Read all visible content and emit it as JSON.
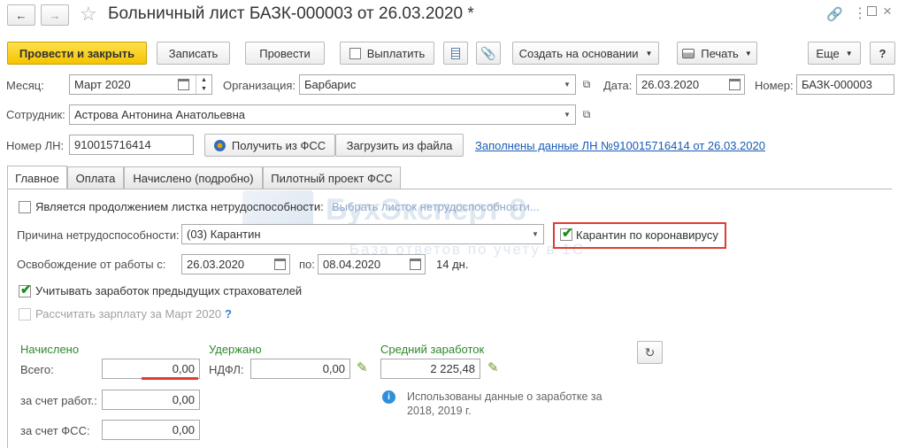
{
  "titlebar": {
    "title": "Больничный лист БАЗК-000003 от 26.03.2020 *"
  },
  "toolbar": {
    "post_close": "Провести и закрыть",
    "save": "Записать",
    "post": "Провести",
    "pay": "Выплатить",
    "create_based": "Создать на основании",
    "print": "Печать",
    "more": "Еще",
    "help": "?"
  },
  "header": {
    "month_label": "Месяц:",
    "month_value": "Март 2020",
    "org_label": "Организация:",
    "org_value": "Барбарис",
    "date_label": "Дата:",
    "date_value": "26.03.2020",
    "number_label": "Номер:",
    "number_value": "БАЗК-000003",
    "employee_label": "Сотрудник:",
    "employee_value": "Астрова Антонина Анатольевна",
    "ln_label": "Номер ЛН:",
    "ln_value": "910015716414",
    "get_fss": "Получить из ФСС",
    "load_file": "Загрузить из файла",
    "filled_link": "Заполнены данные ЛН №910015716414 от 26.03.2020"
  },
  "tabs": [
    "Главное",
    "Оплата",
    "Начислено (подробно)",
    "Пилотный проект ФСС"
  ],
  "main": {
    "continuation_label": "Является продолжением листка нетрудоспособности:",
    "choose_link": "Выбрать листок нетрудоспособности...",
    "reason_label": "Причина нетрудоспособности:",
    "reason_value": "(03) Карантин",
    "covid_label": "Карантин по коронавирусу",
    "release_label": "Освобождение от работы с:",
    "release_from": "26.03.2020",
    "to_label": "по:",
    "release_to": "08.04.2020",
    "days": "14 дн.",
    "prev_insurers_label": "Учитывать заработок предыдущих страхователей",
    "calc_salary_label": "Рассчитать зарплату за Март 2020",
    "question": "?"
  },
  "accrued": {
    "title": "Начислено",
    "total_label": "Всего:",
    "total_value": "0,00",
    "employer_label": "за счет работ.:",
    "employer_value": "0,00",
    "fss_label": "за счет ФСС:",
    "fss_value": "0,00"
  },
  "withheld": {
    "title": "Удержано",
    "ndfl_label": "НДФЛ:",
    "ndfl_value": "0,00"
  },
  "avg": {
    "title": "Средний заработок",
    "value": "2 225,48",
    "info": "Использованы данные о заработке за 2018,  2019 г."
  },
  "watermark": {
    "line1": "БухЭксперт 8",
    "line2": "База ответов по учету в 1С"
  },
  "colors": {
    "primary_button": "#f5c400",
    "highlight_border": "#e03c31",
    "link": "#1a5bb5",
    "section_green": "#2d8a2d"
  }
}
